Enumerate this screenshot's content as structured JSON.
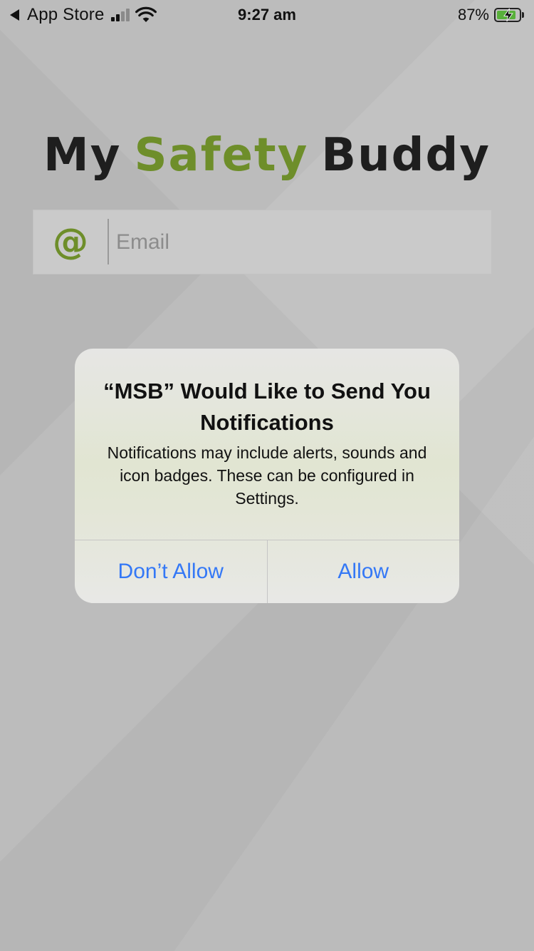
{
  "status_bar": {
    "back_label": "App Store",
    "time": "9:27 am",
    "battery_percent": "87%",
    "battery_level": 0.87,
    "battery_charging": true,
    "signal_bars_active": 2,
    "signal_bars_total": 4,
    "icons": [
      "back-arrow-icon",
      "cellular-signal-icon",
      "wifi-icon",
      "battery-charging-icon"
    ]
  },
  "logo": {
    "word1": "My",
    "word2": "Safety",
    "word3": "Buddy"
  },
  "email_field": {
    "icon_glyph": "@",
    "icon_name": "at-icon",
    "placeholder": "Email",
    "value": ""
  },
  "alert": {
    "title": "“MSB” Would Like to Send You Notifications",
    "message": "Notifications may include alerts, sounds and icon badges. These can be configured in Settings.",
    "deny_label": "Don’t Allow",
    "allow_label": "Allow"
  },
  "colors": {
    "background": "#bcbcbc",
    "logo_dark": "#1e1e1e",
    "brand_green": "#6e8e2a",
    "battery_green": "#58b03a",
    "ios_blue": "#3478f6",
    "signal_active": "#111111",
    "signal_inactive": "#8a8a8a"
  }
}
